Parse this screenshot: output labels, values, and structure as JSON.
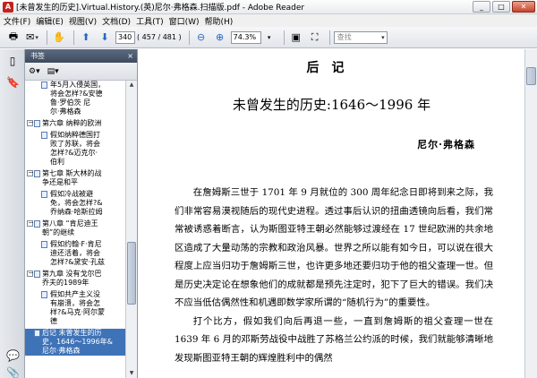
{
  "window": {
    "title": "[未曾发生的历史].Virtual.History.(英)尼尔·弗格森.扫描版.pdf - Adobe Reader",
    "app_icon": "adobe-reader-icon"
  },
  "menu": [
    "文件(F)",
    "编辑(E)",
    "视图(V)",
    "文档(D)",
    "工具(T)",
    "窗口(W)",
    "帮助(H)"
  ],
  "toolbar": {
    "page_field": "340",
    "page_count": "( 457 / 481 )",
    "zoom_value": "74.3%",
    "search_placeholder": "查找"
  },
  "panel": {
    "title": "书签",
    "close_glyph": "×"
  },
  "bookmarks": [
    {
      "level": 1,
      "label": "年5月入侵英国，\n将会怎样?&安德\n鲁·罗伯茨 尼\n尔·弗格森",
      "toggle": ""
    },
    {
      "level": 0,
      "label": "第六章 纳粹的欧洲",
      "toggle": "－"
    },
    {
      "level": 1,
      "label": "假如纳粹德国打\n败了苏联，将会\n怎样?&迈克尔·\n伯利",
      "toggle": ""
    },
    {
      "level": 0,
      "label": "第七章 斯大林的战\n争还是和平",
      "toggle": "－"
    },
    {
      "level": 1,
      "label": "假如冷战被避\n免，将会怎样?&\n乔纳森·哈斯拉姆",
      "toggle": ""
    },
    {
      "level": 0,
      "label": "第八章 “肯尼迪王\n朝”的继续",
      "toggle": "－"
    },
    {
      "level": 1,
      "label": "假如约翰·F·肯尼\n迪还活着，将会\n怎样?&黛安·孔兹",
      "toggle": ""
    },
    {
      "level": 0,
      "label": "第九章 没有戈尔巴\n乔夫的1989年",
      "toggle": "－"
    },
    {
      "level": 1,
      "label": "假如共产主义没\n有崩溃，将会怎\n样?&马克·阿尔蒙\n德",
      "toggle": ""
    },
    {
      "level": 0,
      "label": "后记 未曾发生的历\n史，1646～1996年&\n尼尔·弗格森",
      "toggle": "",
      "selected": true
    }
  ],
  "document": {
    "heading": "后记",
    "subtitle": "未曾发生的历史:1646～1996 年",
    "author": "尼尔·弗格森",
    "paragraphs": [
      "在詹姆斯三世于 1701 年 9 月就位的 300 周年纪念日即将到来之际，我们非常容易漠视随后的现代史进程。透过事后认识的扭曲透镜向后看，我们常常被诱惑着断言，认为斯图亚特王朝必然能够过渡经在 17 世纪欧洲的共余地区造成了大量动荡的宗教和政治风暴。世界之所以能有如今日，可以说在很大程度上应当归功于詹姆斯三世，也许更多地还要归功于他的祖父查理一世。但是历史决定论在想象他们的成就都是预先注定时，犯下了巨大的错误。我们决不应当低估偶然性和机遇即数学家所谓的“随机行为”的重要性。",
      "打个比方，假如我们向后再退一些，一直到詹姆斯的祖父查理一世在 1639 年 6 月的邓斯劳战役中战胜了苏格兰公约派的时候，我们就能够清晰地发现斯图亚特王朝的辉煌胜利中的偶然"
    ]
  },
  "colors": {
    "panel_header": "#4a576b",
    "selected_bookmark": "#3f73b8",
    "close_button": "#c6452c"
  }
}
